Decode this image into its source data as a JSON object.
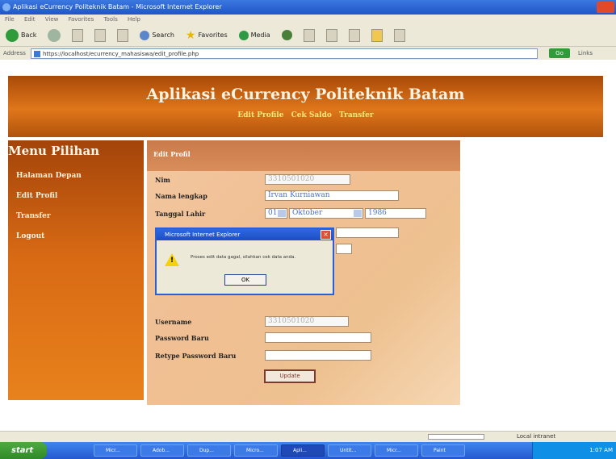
{
  "window": {
    "title": "Aplikasi eCurrency Politeknik Batam - Microsoft Internet Explorer"
  },
  "menubar": {
    "items": [
      "File",
      "Edit",
      "View",
      "Favorites",
      "Tools",
      "Help"
    ]
  },
  "toolbar": {
    "back_label": "Back",
    "search_label": "Search",
    "favorites_label": "Favorites",
    "media_label": "Media"
  },
  "addressbar": {
    "label": "Address",
    "url": "https://localhost/ecurrency_mahasiswa/edit_profile.php",
    "go_label": "Go",
    "links_label": "Links"
  },
  "banner": {
    "title": "Aplikasi eCurrency Politeknik Batam",
    "links": [
      "Edit Profile",
      "Cek Saldo",
      "Transfer"
    ]
  },
  "sidebar": {
    "heading": "Menu Pilihan",
    "items": [
      "Halaman Depan",
      "Edit Profil",
      "Transfer",
      "Logout"
    ]
  },
  "form": {
    "header": "Edit Profil",
    "nim_label": "Nim",
    "nim_value": "3310501020",
    "nama_label": "Nama lengkap",
    "nama_value": "Irvan Kurniawan",
    "tgl_label": "Tanggal Lahir",
    "tgl_day": "01",
    "tgl_month": "Oktober",
    "tgl_year": "1986",
    "username_label": "Username",
    "username_value": "3310501020",
    "password_label": "Password Baru",
    "retype_label": "Retype Password Baru",
    "submit_label": "Update"
  },
  "dialog": {
    "title": "Microsoft Internet Explorer",
    "message": "Proses edit data gagal, silahkan cek data anda.",
    "ok_label": "OK"
  },
  "statusbar": {
    "zone": "Local intranet"
  },
  "taskbar": {
    "start_label": "start",
    "tasks": [
      "Micr...",
      "Adob...",
      "Dup...",
      "Micro...",
      "Apli...",
      "Untit...",
      "Micr...",
      "Paint"
    ],
    "clock": "1:07 AM"
  }
}
